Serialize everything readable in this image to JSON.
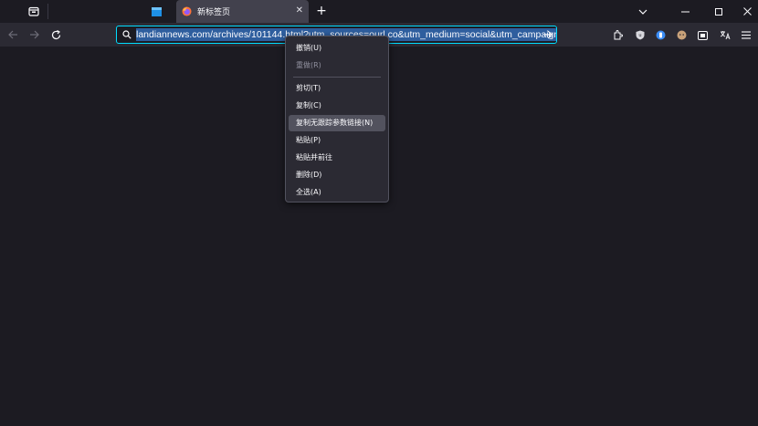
{
  "tabs": {
    "active": {
      "title": "新标签页"
    },
    "new_tab_label": "+",
    "close_label": "✕"
  },
  "urlbar": {
    "value": "landiannews.com/archives/101144.html?utm_sources=ourl.co&utm_medium=social&utm_campaign=r"
  },
  "context_menu": {
    "items": [
      {
        "label": "撤销(U)",
        "disabled": false
      },
      {
        "label": "重做(R)",
        "disabled": true
      },
      {
        "label": "剪切(T)",
        "disabled": false
      },
      {
        "label": "复制(C)",
        "disabled": false
      },
      {
        "label": "复制无跟踪参数链接(N)",
        "disabled": false,
        "highlighted": true
      },
      {
        "label": "粘贴(P)",
        "disabled": false
      },
      {
        "label": "粘贴并前往",
        "disabled": false
      },
      {
        "label": "删除(D)",
        "disabled": false
      },
      {
        "label": "全选(A)",
        "disabled": false
      }
    ]
  },
  "colors": {
    "accent": "#00ddff",
    "background": "#1c1b22",
    "toolbar": "#2b2a33"
  },
  "icons": [
    "firefox-view-icon",
    "pinned-tab-icon",
    "firefox-logo-icon",
    "back-icon",
    "forward-icon",
    "reload-icon",
    "search-icon",
    "go-arrow-icon",
    "extension-icon",
    "ublock-icon",
    "bitwarden-icon",
    "avatar-extension-icon",
    "screenshot-icon",
    "translate-icon",
    "menu-icon",
    "list-all-tabs-icon",
    "minimize-icon",
    "maximize-icon",
    "close-window-icon"
  ]
}
